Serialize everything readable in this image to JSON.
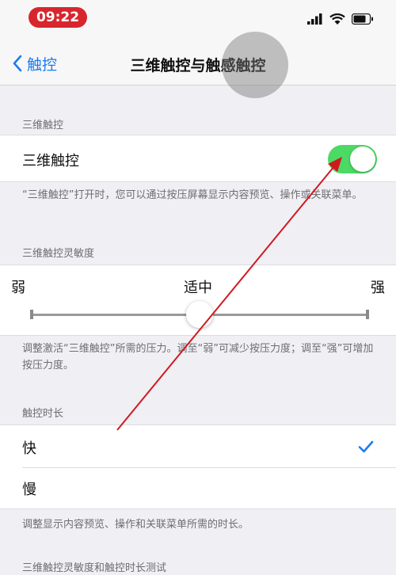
{
  "status_bar": {
    "time": "09:22"
  },
  "nav": {
    "back_label": "触控",
    "title": "三维触控与触感触控"
  },
  "section_3d_touch": {
    "header": "三维触控",
    "row_label": "三维触控",
    "toggle_on": true,
    "footer": "“三维触控”打开时，您可以通过按压屏幕显示内容预览、操作或关联菜单。"
  },
  "section_sensitivity": {
    "header": "三维触控灵敏度",
    "label_light": "弱",
    "label_medium": "适中",
    "label_firm": "强",
    "level": 0.5,
    "footer": "调整激活“三维触控”所需的压力。调至“弱”可减少按压力度；调至“强”可增加按压力度。"
  },
  "section_duration": {
    "header": "触控时长",
    "option_fast": "快",
    "option_slow": "慢",
    "selected": "快",
    "footer": "调整显示内容预览、操作和关联菜单所需的时长。"
  },
  "section_test": {
    "header": "三维触控灵敏度和触控时长测试"
  },
  "colors": {
    "accent": "#1a7cf0",
    "toggle_on": "#4cd964",
    "time_pill": "#d8262d",
    "arrow": "#d0191f"
  }
}
